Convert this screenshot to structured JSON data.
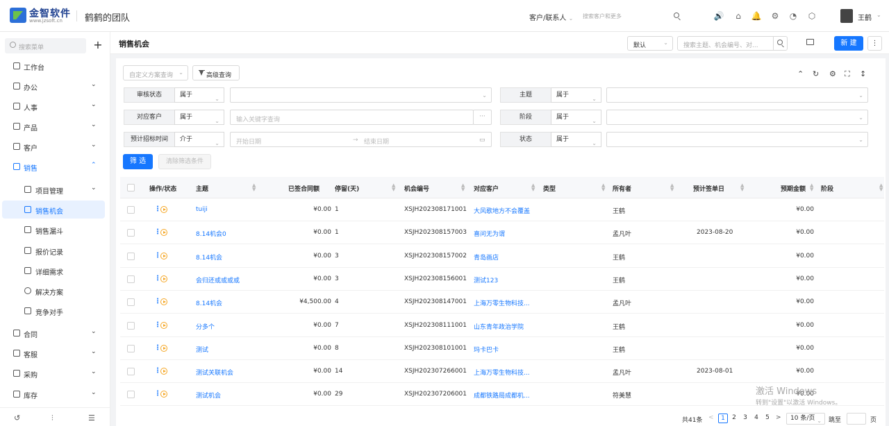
{
  "header": {
    "logo_text": "金智软件",
    "logo_url": "www.jzsoft.cn",
    "team": "鹤鹤的团队",
    "search_scope": "客户/联系人",
    "search_placeholder": "搜索客户和更多",
    "username": "王鹤"
  },
  "sidebar": {
    "search_placeholder": "搜索菜单",
    "plus": "+",
    "items": [
      {
        "label": "工作台"
      },
      {
        "label": "办公"
      },
      {
        "label": "人事"
      },
      {
        "label": "产品"
      },
      {
        "label": "客户"
      },
      {
        "label": "销售"
      },
      {
        "label": "合同"
      },
      {
        "label": "客服"
      },
      {
        "label": "采购"
      },
      {
        "label": "库存"
      }
    ],
    "sub_items": [
      {
        "label": "项目管理"
      },
      {
        "label": "销售机会"
      },
      {
        "label": "销售漏斗"
      },
      {
        "label": "报价记录"
      },
      {
        "label": "详细需求"
      },
      {
        "label": "解决方案"
      },
      {
        "label": "竞争对手"
      }
    ],
    "arrow_down": "⌄",
    "arrow_up": "⌃"
  },
  "page": {
    "title": "销售机会",
    "view_select": "默认",
    "search_placeholder": "搜索主题、机会编号、对...",
    "new_button": "新 建",
    "more": "⋮"
  },
  "filters": {
    "custom_query": "自定义方案查询",
    "advanced": "高级查询",
    "rows": [
      {
        "label": "审核状态",
        "op": "属于",
        "value": ""
      },
      {
        "label": "主题",
        "op": "属于",
        "value": ""
      },
      {
        "label": "对应客户",
        "op": "属于",
        "value": "输入关键字查询"
      },
      {
        "label": "阶段",
        "op": "属于",
        "value": ""
      },
      {
        "label": "预计招标时间",
        "op": "介于",
        "start": "开始日期",
        "end": "结束日期"
      },
      {
        "label": "状态",
        "op": "属于",
        "value": ""
      }
    ],
    "filter_button": "筛 选",
    "clear_button": "清除筛选条件"
  },
  "table": {
    "headers": [
      "操作/状态",
      "主题",
      "已签合同额",
      "停留(天)",
      "机会编号",
      "对应客户",
      "类型",
      "所有者",
      "预计签单日",
      "预期金额",
      "阶段"
    ],
    "rows": [
      {
        "subject": "tuiji",
        "signed": "¥0.00",
        "stay": "1",
        "code": "XSJH202308171001",
        "customer": "大风歌地方不会覆盖",
        "type": "",
        "owner": "王鹤",
        "date": "",
        "amount": "¥0.00",
        "stage": ""
      },
      {
        "subject": "8.14机会0",
        "signed": "¥0.00",
        "stay": "1",
        "code": "XSJH202308157003",
        "customer": "喜问无为谓",
        "type": "",
        "owner": "孟凡叶",
        "date": "2023-08-20",
        "amount": "¥0.00",
        "stage": ""
      },
      {
        "subject": "8.14机会",
        "signed": "¥0.00",
        "stay": "3",
        "code": "XSJH202308157002",
        "customer": "青岛画店",
        "type": "",
        "owner": "王鹤",
        "date": "",
        "amount": "¥0.00",
        "stage": ""
      },
      {
        "subject": "会归还或或或或",
        "signed": "¥0.00",
        "stay": "3",
        "code": "XSJH202308156001",
        "customer": "测试123",
        "type": "",
        "owner": "王鹤",
        "date": "",
        "amount": "¥0.00",
        "stage": ""
      },
      {
        "subject": "8.14机会",
        "signed": "¥4,500.00",
        "stay": "4",
        "code": "XSJH202308147001",
        "customer": "上海万零生物科技...",
        "type": "",
        "owner": "孟凡叶",
        "date": "",
        "amount": "¥0.00",
        "stage": ""
      },
      {
        "subject": "分多个",
        "signed": "¥0.00",
        "stay": "7",
        "code": "XSJH202308111001",
        "customer": "山东青年政治学院",
        "type": "",
        "owner": "王鹤",
        "date": "",
        "amount": "¥0.00",
        "stage": ""
      },
      {
        "subject": "测试",
        "signed": "¥0.00",
        "stay": "8",
        "code": "XSJH202308101001",
        "customer": "玛卡巴卡",
        "type": "",
        "owner": "王鹤",
        "date": "",
        "amount": "¥0.00",
        "stage": ""
      },
      {
        "subject": "测试关联机会",
        "signed": "¥0.00",
        "stay": "14",
        "code": "XSJH202307266001",
        "customer": "上海万零生物科技...",
        "type": "",
        "owner": "孟凡叶",
        "date": "2023-08-01",
        "amount": "¥0.00",
        "stage": ""
      },
      {
        "subject": "测试机会",
        "signed": "¥0.00",
        "stay": "29",
        "code": "XSJH202307206001",
        "customer": "成都铁路局成都机...",
        "type": "",
        "owner": "符美慧",
        "date": "",
        "amount": "¥0.00",
        "stage": ""
      }
    ]
  },
  "pagination": {
    "total": "共41条",
    "prev": "<",
    "next": ">",
    "pages": [
      "1",
      "2",
      "3",
      "4",
      "5"
    ],
    "current": "1",
    "page_size": "10 条/页",
    "jump_label": "跳至",
    "page_suffix": "页"
  },
  "watermark": {
    "line1": "激活 Windows",
    "line2": "转到\"设置\"以激活 Windows。"
  },
  "colors": {
    "primary": "#1677ff",
    "accent_orange": "#f5a623"
  }
}
